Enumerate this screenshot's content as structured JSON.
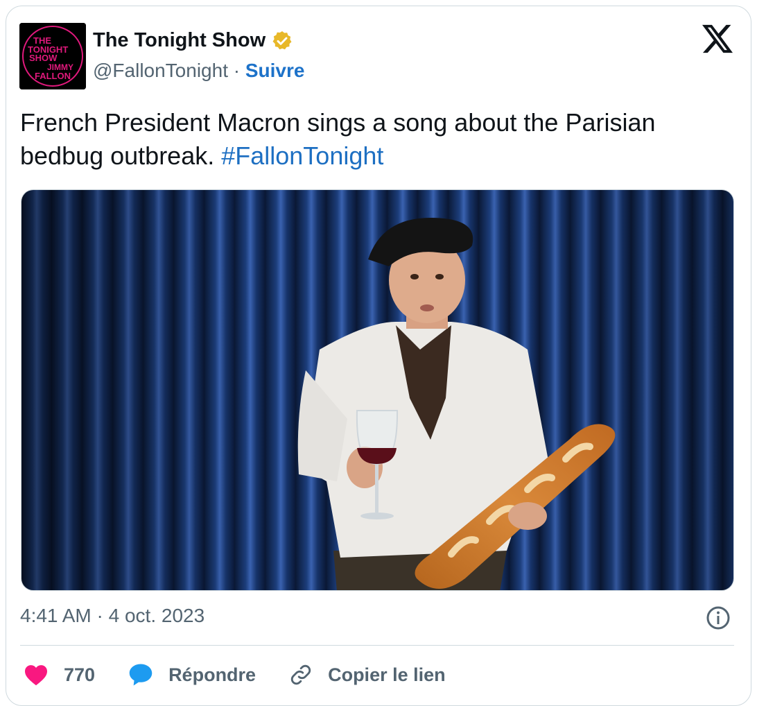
{
  "account": {
    "name": "The Tonight Show",
    "handle": "@FallonTonight",
    "separator": " · ",
    "follow_label": "Suivre",
    "avatar_text": [
      "THE",
      "TONIGHT",
      "SHOW",
      "JIMMY",
      "FALLON"
    ]
  },
  "tweet": {
    "text": "French President Macron sings a song about the Parisian bedbug outbreak. ",
    "hashtag": "#FallonTonight"
  },
  "meta": {
    "time": "4:41 AM",
    "separator": " · ",
    "date": "4 oct. 2023"
  },
  "actions": {
    "like_count": "770",
    "reply_label": "Répondre",
    "copy_link_label": "Copier le lien"
  },
  "icons": {
    "logo": "x-logo-icon",
    "verified": "verified-badge-icon",
    "info": "info-icon",
    "like": "heart-icon",
    "reply": "speech-bubble-icon",
    "link": "link-icon"
  },
  "colors": {
    "link": "#1d72c9",
    "verified": "#e8b829",
    "heart": "#f91880",
    "reply": "#1d9bf0",
    "muted": "#536471",
    "avatar_text": "#e0197c"
  }
}
